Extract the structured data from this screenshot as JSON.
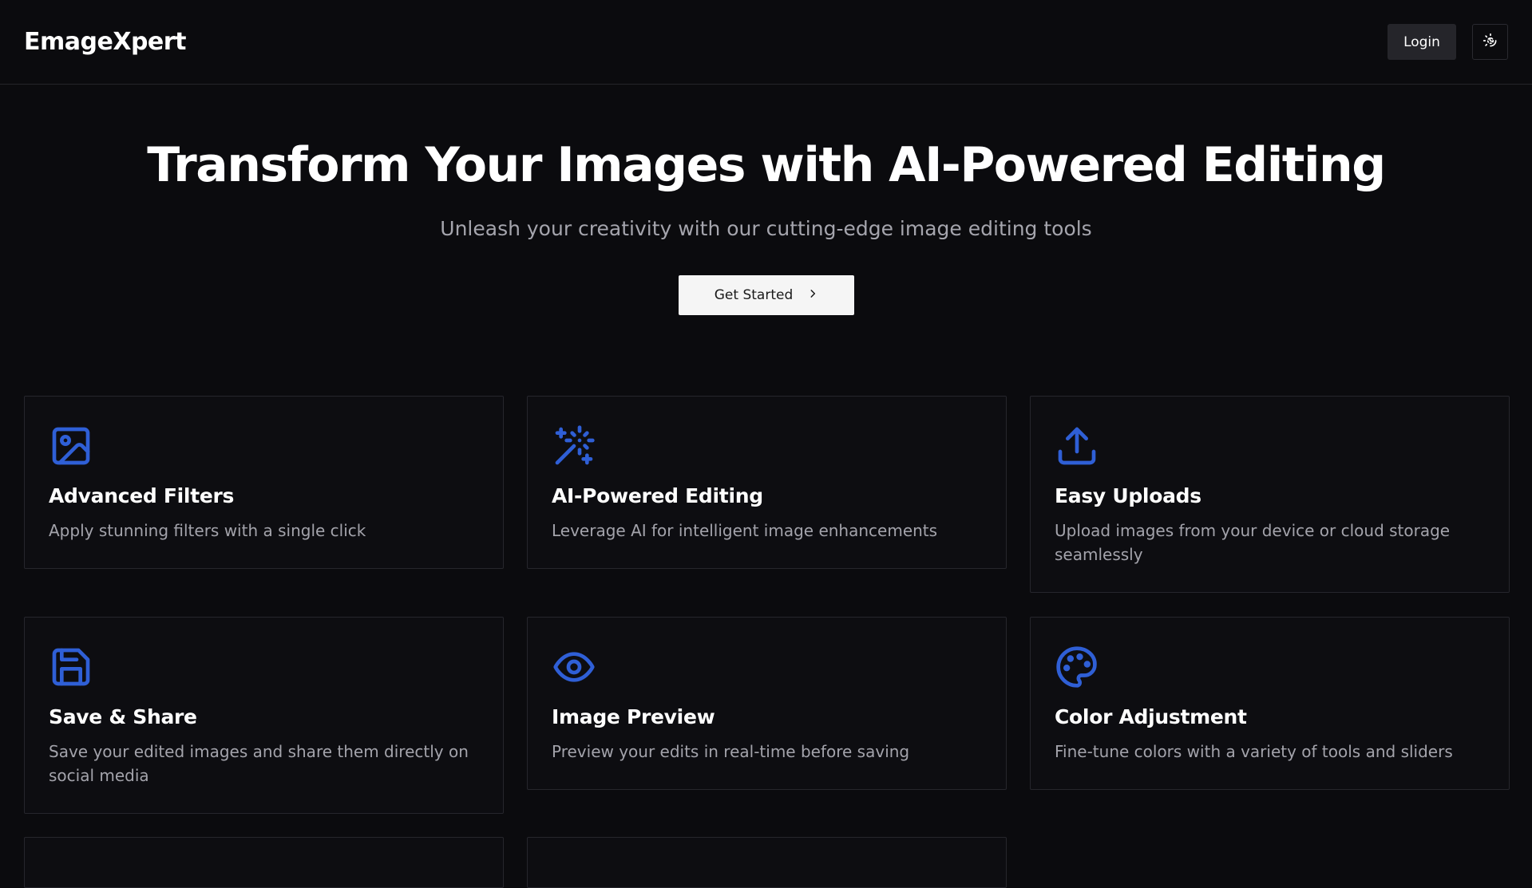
{
  "header": {
    "logo": "EmageXpert",
    "login_label": "Login",
    "theme_toggle_icon": "moon-sun-icon"
  },
  "hero": {
    "title": "Transform Your Images with AI-Powered Editing",
    "subtitle": "Unleash your creativity with our cutting-edge image editing tools",
    "cta_label": "Get Started",
    "cta_icon": "chevron-right-icon"
  },
  "features": [
    {
      "icon": "image-icon",
      "title": "Advanced Filters",
      "description": "Apply stunning filters with a single click"
    },
    {
      "icon": "magic-wand-icon",
      "title": "AI-Powered Editing",
      "description": "Leverage AI for intelligent image enhancements"
    },
    {
      "icon": "upload-icon",
      "title": "Easy Uploads",
      "description": "Upload images from your device or cloud storage seamlessly"
    },
    {
      "icon": "save-icon",
      "title": "Save & Share",
      "description": "Save your edited images and share them directly on social media"
    },
    {
      "icon": "eye-icon",
      "title": "Image Preview",
      "description": "Preview your edits in real-time before saving"
    },
    {
      "icon": "palette-icon",
      "title": "Color Adjustment",
      "description": "Fine-tune colors with a variety of tools and sliders"
    }
  ],
  "colors": {
    "background": "#0b0b0e",
    "accent": "#2f5fd6",
    "muted_text": "#a3a3ab",
    "border": "#26262c"
  }
}
